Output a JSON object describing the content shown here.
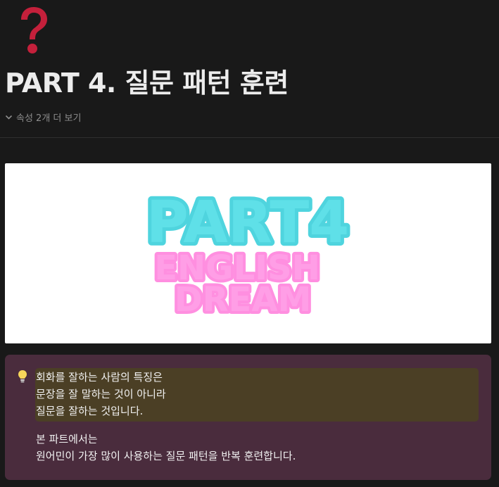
{
  "page": {
    "icon": "red-question-mark-icon",
    "title": "PART 4. 질문 패턴 훈련",
    "properties_toggle_label": "속성 2개 더 보기"
  },
  "cover": {
    "line1": "PART4",
    "line2": "ENGLISH",
    "line3": "DREAM",
    "colors": {
      "line1": "#5fe0e8",
      "line2_3": "#ff9ee6"
    }
  },
  "callout": {
    "icon": "lightbulb-icon",
    "highlight_lines": [
      "회화를 잘하는 사람의 특징은",
      "문장을 잘 말하는 것이 아니라",
      "질문을 잘하는 것입니다."
    ],
    "body_lines": [
      "본 파트에서는",
      "원어민이 가장 많이 사용하는 질문 패턴을 반복 훈련합니다."
    ],
    "colors": {
      "background": "#4a2c3d",
      "highlight": "#4b3f25"
    }
  }
}
